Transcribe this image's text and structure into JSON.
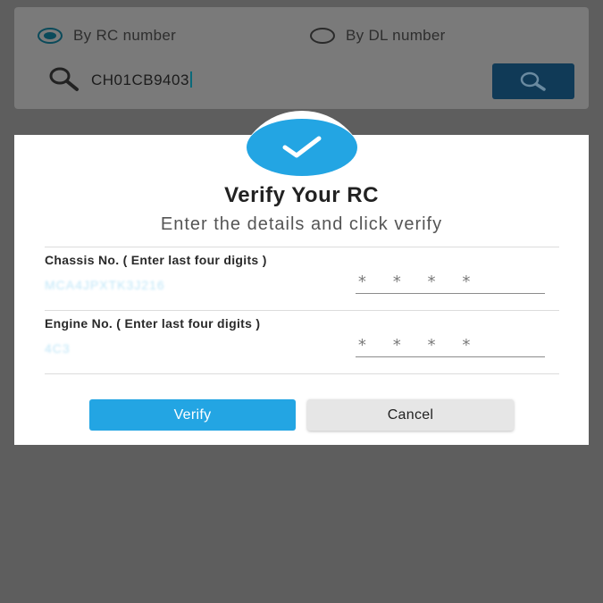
{
  "search": {
    "option_rc": "By RC number",
    "option_dl": "By DL number",
    "selected": "rc",
    "query": "CH01CB9403"
  },
  "dialog": {
    "title": "Verify Your RC",
    "subtitle": "Enter the details and click verify",
    "chassis": {
      "label": "Chassis No. ( Enter last four digits )",
      "hint": "MCA4JPXTK3J216",
      "placeholder": "****"
    },
    "engine": {
      "label": "Engine No. ( Enter last four digits )",
      "hint": "4C3",
      "placeholder": "****"
    },
    "verify_label": "Verify",
    "cancel_label": "Cancel"
  },
  "colors": {
    "accent": "#23a5e3",
    "overlay": "#5e5e5e",
    "search_button": "#103a57"
  }
}
